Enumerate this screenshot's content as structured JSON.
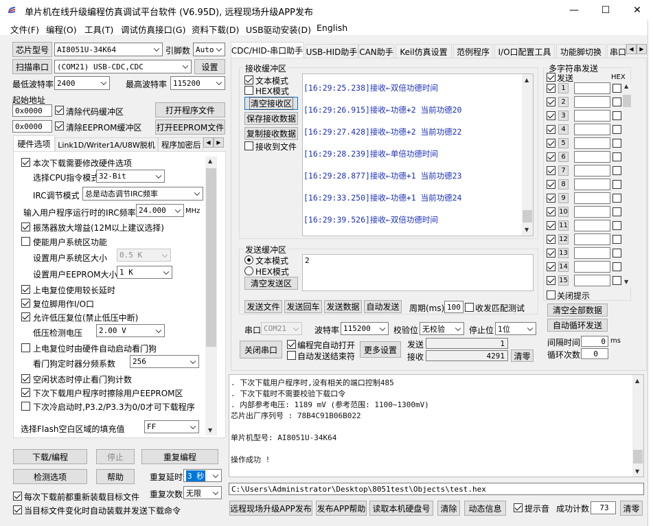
{
  "window": {
    "title": "单片机在线升级编程仿真调试平台软件 (V6.95D), 远程现场升级APP发布",
    "minimize": "—",
    "maximize": "☐",
    "close": "✕"
  },
  "menu": [
    "文件(F)",
    "编程(O)",
    "工具(T)",
    "调试仿真接口(G)",
    "资料下载(D)",
    "USB驱动安装(D)",
    "English"
  ],
  "left": {
    "chip_model_btn": "芯片型号",
    "chip_model": "AI8051U-34K64",
    "pin_label": "引脚数",
    "pin_value": "Auto",
    "scan_port_btn": "扫描串口",
    "port_value": "(COM21) USB-CDC,CDC",
    "settings_btn": "设置",
    "min_baud_label": "最低波特率",
    "min_baud": "2400",
    "max_baud_label": "最高波特率",
    "max_baud": "115200",
    "start_addr_label": "起始地址",
    "addr1": "0x0000",
    "clear_code_label": "清除代码缓冲区",
    "open_prog_btn": "打开程序文件",
    "addr2": "0x0000",
    "clear_eeprom_label": "清除EEPROM缓冲区",
    "open_eeprom_btn": "打开EEPROM文件",
    "tabs": [
      "硬件选项",
      "Link1D/Writer1A/U8W脱机",
      "程序加密后"
    ]
  },
  "hw": {
    "opt1": "本次下载需要修改硬件选项",
    "cpu_label": "选择CPU指令模式",
    "cpu_value": "32-Bit",
    "irc_label": "IRC调节模式",
    "irc_value": "总是动态调节IRC频率",
    "freq_label": "输入用户程序运行时的IRC频率",
    "freq_value": "24.000",
    "freq_unit": "MHz",
    "opt_osc": "振荡器放大增益(12M以上建议选择)",
    "opt_sys": "使能用户系统区功能",
    "sys_size_label": "设置用户系统区大小",
    "sys_size": "0.5 K",
    "eeprom_size_label": "设置用户EEPROM大小",
    "eeprom_size": "1   K",
    "opt_reset_delay": "上电复位使用较长延时",
    "opt_reset_io": "复位脚用作I/O口",
    "opt_lvr": "允许低压复位(禁止低压中断)",
    "lvd_label": "低压检测电压",
    "lvd_value": "2.00 V",
    "opt_wdt": "上电复位时由硬件自动启动看门狗",
    "wdt_label": "看门狗定时器分频系数",
    "wdt_value": "256",
    "opt_idle_wdt": "空闲状态时停止看门狗计数",
    "opt_erase_eeprom": "下次下载用户程序时擦除用户EEPROM区",
    "opt_p32": "下次冷启动时,P3.2/P3.3为0/0才可下载程序",
    "flash_fill_label": "选择Flash空白区域的填充值",
    "flash_fill": "FF"
  },
  "bottom_left": {
    "download_btn": "下载/编程",
    "stop_btn": "停止",
    "reprogram_btn": "重复编程",
    "detect_btn": "检测选项",
    "help_btn": "帮助",
    "repeat_delay_label": "重复延时",
    "repeat_delay": "3 秒",
    "repeat_count_label": "重复次数",
    "repeat_count": "无限",
    "reload_label": "每次下载前都重新装载目标文件",
    "auto_reload_label": "当目标文件变化时自动装载并发送下载命令"
  },
  "right_tabs": [
    "CDC/HID-串口助手",
    "USB-HID助手",
    "CAN助手",
    "Keil仿真设置",
    "范例程序",
    "I/O口配置工具",
    "功能脚切换",
    "串口"
  ],
  "recv": {
    "group_title": "接收缓冲区",
    "text_mode": "文本模式",
    "hex_mode": "HEX模式",
    "clear_btn": "清空接收区",
    "save_btn": "保存接收数据",
    "copy_btn": "复制接收数据",
    "to_file": "接收到文件",
    "lines": [
      "[16:29:25.238]接收←双倍功德时间",
      "[16:29:26.915]接收←功德+2 当前功德20",
      "[16:29:27.428]接收←功德+2 当前功德22",
      "[16:29:28.239]接收←单倍功德时间",
      "[16:29:28.877]接收←功德+1 当前功德23",
      "[16:29:33.250]接收←功德+1 当前功德24",
      "[16:29:39.526]接收←双倍功德时间"
    ]
  },
  "send": {
    "group_title": "发送缓冲区",
    "text_mode": "文本模式",
    "hex_mode": "HEX模式",
    "clear_btn": "清空发送区",
    "content": "2",
    "send_file_btn": "发送文件",
    "send_enter_btn": "发送回车",
    "send_data_btn": "发送数据",
    "auto_send_btn": "自动发送",
    "period_label": "周期(ms)",
    "period_value": "100",
    "match_label": "收发匹配测试"
  },
  "serial": {
    "port_label": "串口",
    "port_value": "COM21",
    "baud_label": "波特率",
    "baud_value": "115200",
    "parity_label": "校验位",
    "parity_value": "无校验",
    "stop_label": "停止位",
    "stop_value": "1位",
    "close_btn": "关闭串口",
    "auto_open_label": "编程完自动打开",
    "auto_end_label": "自动发送结束符",
    "more_btn": "更多设置",
    "sent_label": "发送",
    "sent_value": "1",
    "recv_label": "接收",
    "recv_value": "4291",
    "clear_btn": "清零"
  },
  "multi": {
    "title": "多字符串发送",
    "send_header": "发送",
    "hex_header": "HEX",
    "rows": [
      "1",
      "2",
      "3",
      "4",
      "5",
      "6",
      "7",
      "8",
      "9",
      "10",
      "11",
      "12",
      "13",
      "14",
      "15"
    ],
    "close_tip": "关闭提示",
    "clear_all_btn": "清空全部数据",
    "auto_loop_btn": "自动循环发送",
    "interval_label": "间隔时间",
    "interval_value": "0",
    "interval_unit": "ms",
    "loop_label": "循环次数",
    "loop_value": "0"
  },
  "log": {
    "lines": [
      "  . 下次下载用户程序时,没有相关的端口控制485",
      "  . 下次下载时不需要校验下载口令",
      "  . 内部参考电压: 1189 mV (参考范围: 1100~1300mV)",
      "芯片出厂序列号 : 78B4C91B06B022",
      "",
      "  单片机型号: AI8051U-34K64",
      "",
      "操作成功 !"
    ],
    "path": "C:\\Users\\Administrator\\Desktop\\8051test\\Objects\\test.hex"
  },
  "footer": {
    "publish_btn": "远程现场升级APP发布",
    "publish_help_btn": "发布APP帮助",
    "read_disk_btn": "读取本机硬盘号",
    "clear_btn": "清除",
    "anim_btn": "动态信息",
    "sound_label": "提示音",
    "success_label": "成功计数",
    "success_value": "73",
    "reset_btn": "清零"
  },
  "colors": {
    "recv_text": "#1a2fbd",
    "selection": "#0078d7"
  }
}
